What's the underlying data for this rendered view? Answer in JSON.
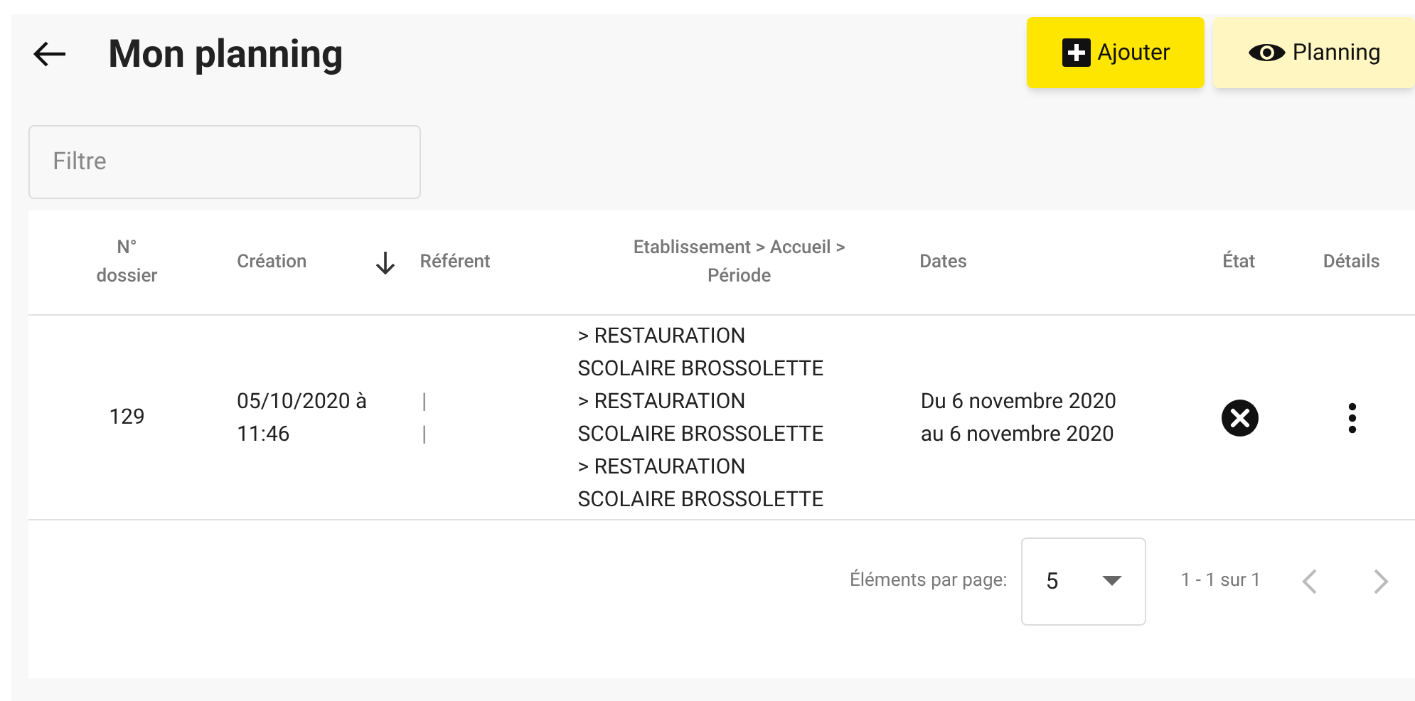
{
  "header": {
    "title": "Mon planning",
    "buttons": [
      {
        "label": "Ajouter",
        "kind": "add"
      },
      {
        "label": "Planning",
        "kind": "view"
      }
    ]
  },
  "filter": {
    "placeholder": "Filtre"
  },
  "table": {
    "columns": [
      {
        "label": "N° dossier",
        "sorted": false
      },
      {
        "label": "Création",
        "sorted": true
      },
      {
        "label": "Référent",
        "sorted": false
      },
      {
        "label": "Etablissement > Accueil > Période",
        "sorted": false
      },
      {
        "label": "Dates",
        "sorted": false
      },
      {
        "label": "État",
        "sorted": false
      },
      {
        "label": "Détails",
        "sorted": false
      }
    ],
    "rows": [
      {
        "dossier": "129",
        "creation": "05/10/2020 à 11:46",
        "referent": [
          "|",
          "|"
        ],
        "etablissement": [
          "> RESTAURATION",
          "SCOLAIRE BROSSOLETTE",
          "> RESTAURATION",
          "SCOLAIRE BROSSOLETTE",
          "> RESTAURATION",
          "SCOLAIRE BROSSOLETTE"
        ],
        "dates": [
          "Du 6 novembre 2020",
          "au 6 novembre 2020"
        ],
        "cancelled": true
      }
    ]
  },
  "paginator": {
    "label": "Éléments par page:",
    "page_size": "5",
    "range": "1 - 1 sur 1",
    "prev_disabled": true,
    "next_disabled": true
  }
}
